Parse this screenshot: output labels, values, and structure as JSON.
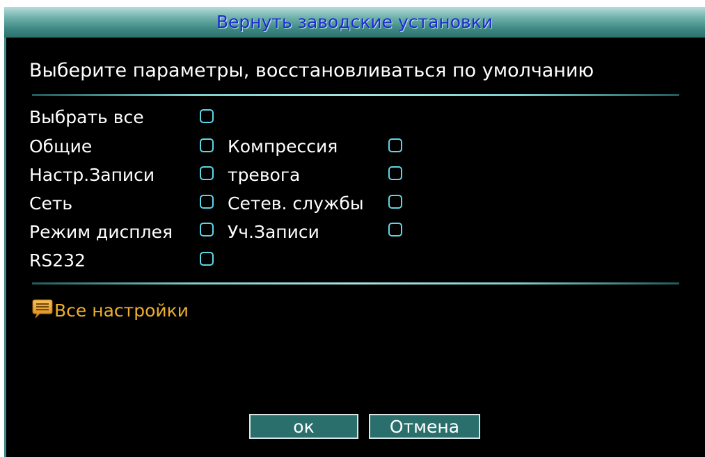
{
  "dialog": {
    "title": "Вернуть заводские установки",
    "subtitle": "Выберите параметры, восстановливаться по умолчанию"
  },
  "options": {
    "select_all": "Выбрать все",
    "general": "Общие",
    "compression": "Компрессия",
    "record_config": "Настр.Записи",
    "alarm": "тревога",
    "network": "Сеть",
    "net_services": "Сетев. службы",
    "display_mode": "Режим дисплея",
    "user_accounts": "Уч.Записи",
    "rs232": "RS232"
  },
  "checkbox_state": {
    "select_all": false,
    "general": false,
    "compression": false,
    "record_config": false,
    "alarm": false,
    "network": false,
    "net_services": false,
    "display_mode": false,
    "user_accounts": false,
    "rs232": false
  },
  "info": {
    "icon": "message-icon",
    "text": "Все настройки"
  },
  "buttons": {
    "ok": "ок",
    "cancel": "Отмена"
  },
  "colors": {
    "title_text": "#1a2bd6",
    "checkbox_border": "#5fd6e6",
    "info_text": "#ecae2e",
    "button_bg": "#2b6f6c"
  }
}
